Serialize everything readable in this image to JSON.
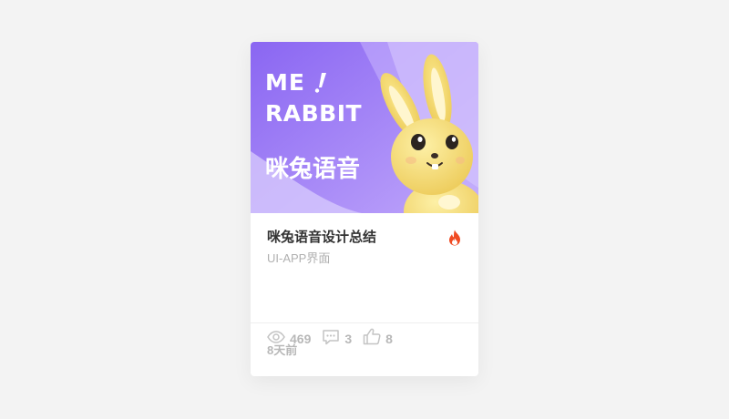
{
  "card": {
    "cover": {
      "headline_line1": "ME",
      "headline_line2": "RABBIT",
      "subtitle": "咪兔语音",
      "colors": {
        "bg_start": "#8f6cf4",
        "bg_end": "#c2adfb",
        "wave": "#ddd2fd",
        "rabbit": "#f7de73"
      }
    },
    "title": "咪兔语音设计总结",
    "category": "UI-APP界面",
    "hot_icon": "fire-icon",
    "hot_color": "#f04b23",
    "stats": {
      "views": "469",
      "comments": "3",
      "likes": "8"
    },
    "time_ago": "8天前"
  }
}
